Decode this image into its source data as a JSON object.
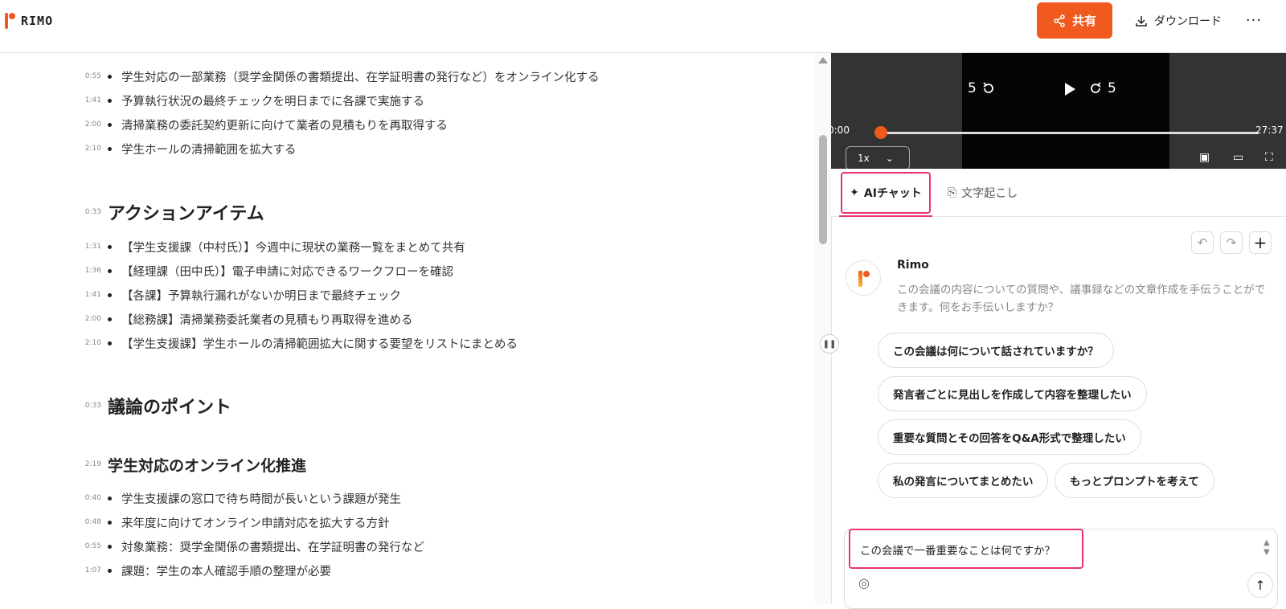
{
  "header": {
    "logo_text": "RIMO",
    "share_label": "共有",
    "download_label": "ダウンロード",
    "more_label": "···"
  },
  "transcript": {
    "items": [
      {
        "ts": "0:55",
        "text": "学生対応の一部業務（奨学金関係の書類提出、在学証明書の発行など）をオンライン化する"
      },
      {
        "ts": "1:41",
        "text": "予算執行状況の最終チェックを明日までに各課で実施する"
      },
      {
        "ts": "2:00",
        "text": "清掃業務の委託契約更新に向けて業者の見積もりを再取得する"
      },
      {
        "ts": "2:10",
        "text": "学生ホールの清掃範囲を拡大する"
      }
    ],
    "action_heading": {
      "ts": "0:33",
      "text": "アクションアイテム"
    },
    "actions": [
      {
        "ts": "1:31",
        "text": "【学生支援課（中村氏）】今週中に現状の業務一覧をまとめて共有"
      },
      {
        "ts": "1:36",
        "text": "【経理課（田中氏）】電子申請に対応できるワークフローを確認"
      },
      {
        "ts": "1:41",
        "text": "【各課】予算執行漏れがないか明日まで最終チェック"
      },
      {
        "ts": "2:00",
        "text": "【総務課】清掃業務委託業者の見積もり再取得を進める"
      },
      {
        "ts": "2:10",
        "text": "【学生支援課】学生ホールの清掃範囲拡大に関する要望をリストにまとめる"
      }
    ],
    "points_heading": {
      "ts": "0:33",
      "text": "議論のポイント"
    },
    "sub_heading": {
      "ts": "2:19",
      "text": "学生対応のオンライン化推進"
    },
    "points": [
      {
        "ts": "0:40",
        "text": "学生支援課の窓口で待ち時間が長いという課題が発生"
      },
      {
        "ts": "0:48",
        "text": "来年度に向けてオンライン申請対応を拡大する方針"
      },
      {
        "ts": "0:55",
        "text": "対象業務：奨学金関係の書類提出、在学証明書の発行など"
      },
      {
        "ts": "1:07",
        "text": "課題：学生の本人確認手順の整理が必要"
      }
    ]
  },
  "video": {
    "rewind_label": "5",
    "forward_label": "5",
    "current_time": "0:00",
    "duration": "27:37",
    "progress": 0.0,
    "speed": "1x"
  },
  "tabs": {
    "ai_chat": "AIチャット",
    "transcript": "文字起こし"
  },
  "chat": {
    "bot_name": "Rimo",
    "bot_message": "この会議の内容についての質問や、議事録などの文章作成を手伝うことができます。何をお手伝いしますか？",
    "suggestions": [
      "この会議は何について話されていますか？",
      "発言者ごとに見出しを作成して内容を整理したい",
      "重要な質問とその回答をQ&A形式で整理したい",
      "私の発言についてまとめたい",
      "もっとプロンプトを考えて"
    ],
    "input_value": "この会議で一番重要なことは何ですか？"
  },
  "colors": {
    "accent": "#f05a1e",
    "highlight": "#e8336b"
  }
}
